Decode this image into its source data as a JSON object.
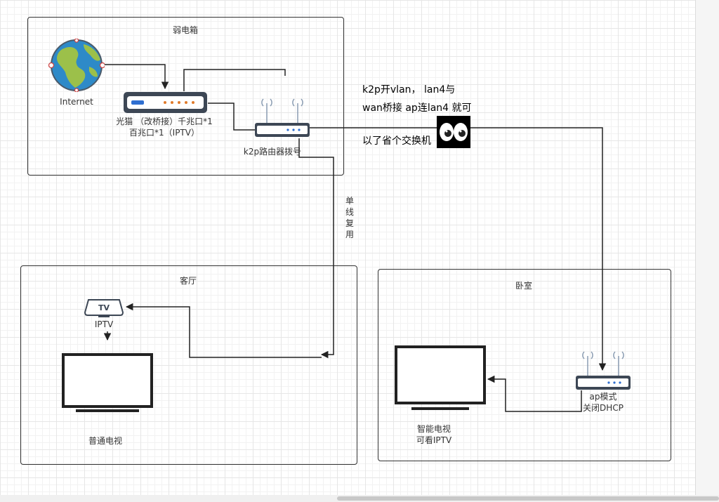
{
  "containers": {
    "weak_box_title": "弱电箱",
    "living_room_title": "客厅",
    "bedroom_title": "卧室"
  },
  "nodes": {
    "internet": "Internet",
    "modem_line1": "光猫 （改桥接）千兆口*1",
    "modem_line2": "百兆口*1（IPTV）",
    "k2p_router": "k2p路由器拨号",
    "iptv_box_icon_text": "TV",
    "iptv_box": "IPTV",
    "normal_tv": "普通电视",
    "ap_line1": "ap模式",
    "ap_line2": "关闭DHCP",
    "smart_tv_line1": "智能电视",
    "smart_tv_line2": "可看IPTV"
  },
  "edges": {
    "single_wire_reuse": [
      "单",
      "线",
      "复",
      "用"
    ]
  },
  "notes": {
    "line1": "k2p开vlan， lan4与",
    "line2": "wan桥接 ap连lan4 就可",
    "line3": "以了省个交换机"
  },
  "icons": {
    "globe": "globe-icon",
    "modem": "modem-icon",
    "router": "router-icon",
    "eyes": "eyes-emoji-icon",
    "tv": "tv-icon",
    "tvbox": "tv-box-icon"
  }
}
